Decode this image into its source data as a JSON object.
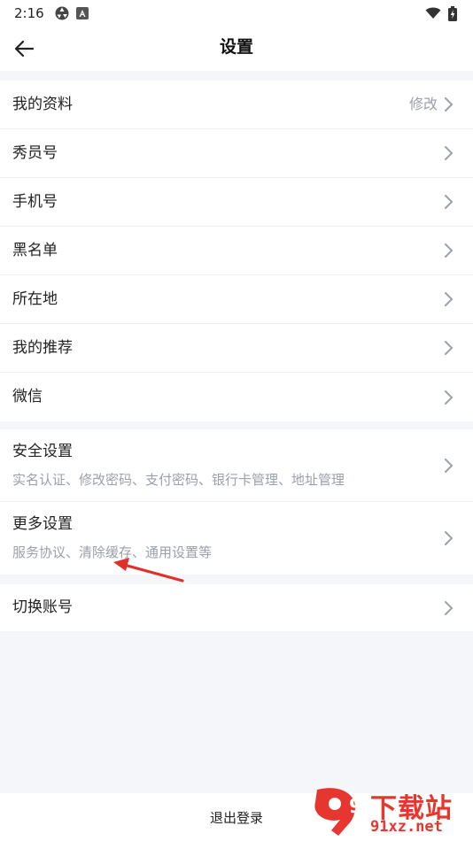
{
  "status_bar": {
    "time": "2:16",
    "icons_left": [
      "aperture-icon",
      "a-badge-icon"
    ],
    "icons_right": [
      "wifi-icon",
      "battery-icon"
    ]
  },
  "header": {
    "title": "设置",
    "back_icon": "arrow-left-icon"
  },
  "groups": {
    "profile": [
      {
        "label": "我的资料",
        "value": "修改"
      },
      {
        "label": "秀员号"
      },
      {
        "label": "手机号"
      },
      {
        "label": "黑名单"
      },
      {
        "label": "所在地"
      },
      {
        "label": "我的推荐"
      },
      {
        "label": "微信"
      }
    ],
    "settings": [
      {
        "label": "安全设置",
        "sub": "实名认证、修改密码、支付密码、银行卡管理、地址管理"
      },
      {
        "label": "更多设置",
        "sub": "服务协议、清除缓存、通用设置等"
      }
    ],
    "account": [
      {
        "label": "切换账号"
      }
    ]
  },
  "logout": {
    "label": "退出登录"
  },
  "watermark": {
    "logo_text": "9",
    "top": "下载站",
    "bottom": "91xz.net"
  },
  "colors": {
    "background": "#f5f6f9",
    "card": "#ffffff",
    "secondary_text": "#9a9fa8",
    "annotation_arrow": "#e0302a",
    "watermark": "#e6362f"
  }
}
